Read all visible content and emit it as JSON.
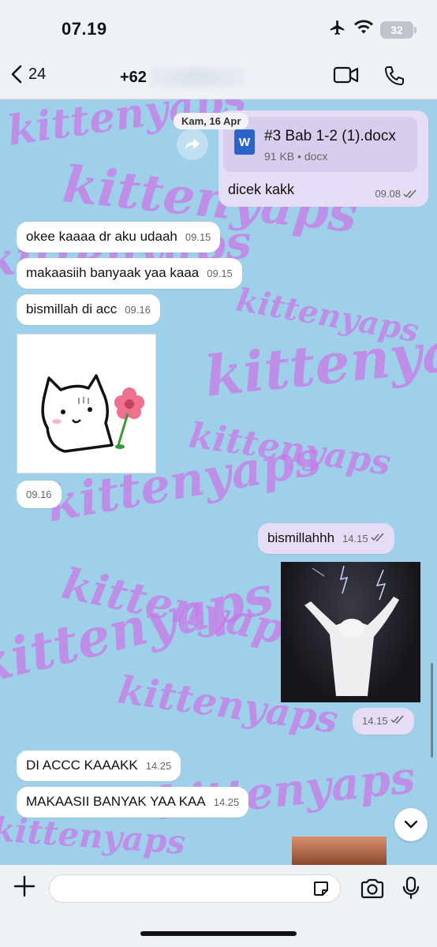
{
  "status_bar": {
    "time": "07.19",
    "battery": "32"
  },
  "header": {
    "back_count": "24",
    "contact_name": "+62"
  },
  "date_separator": "Kam, 16 Apr",
  "messages": [
    {
      "id": "m1",
      "dir": "out",
      "type": "document",
      "file_name": "#3 Bab 1-2 (1).docx",
      "file_meta": "91 KB • docx",
      "word_icon": "W",
      "caption": "dicek kakk",
      "time": "09.08",
      "status": "read"
    },
    {
      "id": "m2",
      "dir": "in",
      "type": "text",
      "text": "okee kaaaa dr aku udaah",
      "time": "09.15"
    },
    {
      "id": "m3",
      "dir": "in",
      "type": "text",
      "text": "makaasiih banyaak yaa kaaa",
      "time": "09.15"
    },
    {
      "id": "m4",
      "dir": "in",
      "type": "text",
      "text": "bismillah di acc",
      "time": "09.16"
    },
    {
      "id": "m5",
      "dir": "in",
      "type": "sticker",
      "time": "09.16"
    },
    {
      "id": "m6",
      "dir": "out",
      "type": "text",
      "text": "bismillahhh",
      "time": "14.15",
      "status": "read"
    },
    {
      "id": "m7",
      "dir": "out",
      "type": "image",
      "time": "14.15",
      "status": "read"
    },
    {
      "id": "m8",
      "dir": "in",
      "type": "text",
      "text": "DI ACCC KAAAKK",
      "time": "14.25"
    },
    {
      "id": "m9",
      "dir": "in",
      "type": "text",
      "text": "MAKAASII BANYAK YAA KAA",
      "time": "14.25"
    }
  ],
  "wallpaper_text": "kittenyaps",
  "composer": {
    "placeholder": "",
    "value": ""
  },
  "icons": [
    "back-chevron-icon",
    "video-call-icon",
    "phone-icon",
    "forward-icon",
    "word-doc-icon",
    "read-check-icon",
    "chevron-down-icon",
    "plus-icon",
    "sticker-icon",
    "camera-icon",
    "mic-icon",
    "airplane-icon",
    "wifi-icon",
    "battery-icon"
  ],
  "colors": {
    "outgoing_bubble": "#e5dcf5",
    "incoming_bubble": "#ffffff",
    "wallpaper_bg": "#9fd0ea",
    "wallpaper_text": "#c77ae6",
    "bar_bg": "#eef2f7"
  }
}
